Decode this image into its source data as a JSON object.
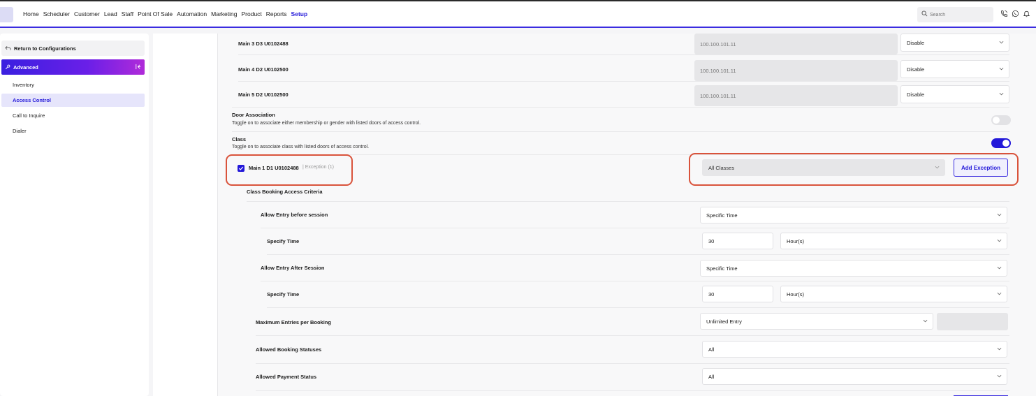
{
  "nav": {
    "items": [
      "Home",
      "Scheduler",
      "Customer",
      "Lead",
      "Staff",
      "Point Of Sale",
      "Automation",
      "Marketing",
      "Product",
      "Reports",
      "Setup"
    ],
    "active": "Setup",
    "search_placeholder": "Search"
  },
  "sidebar": {
    "return_label": "Return to Configurations",
    "section_label": "Advanced",
    "items": [
      {
        "label": "Inventory",
        "active": false
      },
      {
        "label": "Access Control",
        "active": true
      },
      {
        "label": "Call to Inquire",
        "active": false
      },
      {
        "label": "Dialer",
        "active": false
      }
    ]
  },
  "doors": [
    {
      "name": "Main 3 D3 U0102488",
      "ip": "100.100.101.11",
      "status": "Disable"
    },
    {
      "name": "Main 4 D2 U0102500",
      "ip": "100.100.101.11",
      "status": "Disable"
    },
    {
      "name": "Main 5 D2 U0102500",
      "ip": "100.100.101.11",
      "status": "Disable"
    }
  ],
  "door_association": {
    "title": "Door Association",
    "description": "Toggle on to associate either membership or gender with listed doors of access control.",
    "enabled": false
  },
  "class_section": {
    "title": "Class",
    "description": "Toggle on to associate class with listed doors of access control.",
    "enabled": true
  },
  "class_door": {
    "name": "Main 1 D1 U0102488",
    "exception_text": "| Exception (1)",
    "checked": true,
    "class_select": "All Classes",
    "add_exception_label": "Add Exception"
  },
  "criteria": {
    "title": "Class Booking Access Criteria",
    "rows": [
      {
        "label": "Allow Entry before session",
        "value": "Specific Time"
      },
      {
        "label": "Specify Time",
        "value": "30",
        "unit": "Hour(s)"
      },
      {
        "label": "Allow Entry After Session",
        "value": "Specific Time"
      },
      {
        "label": "Specify Time",
        "value": "30",
        "unit": "Hour(s)"
      },
      {
        "label": "Maximum Entries per Booking",
        "value": "Unlimited Entry"
      },
      {
        "label": "Allowed Booking Statuses",
        "value": "All"
      },
      {
        "label": "Allowed Payment Status",
        "value": "All"
      }
    ]
  },
  "colors": {
    "accent": "#2318d9",
    "highlight": "#d9533b"
  }
}
